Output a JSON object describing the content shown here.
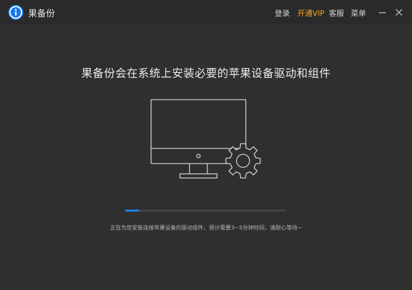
{
  "app": {
    "name": "果备份",
    "logo_icon": "info-circle-icon",
    "brand_color": "#1677e6"
  },
  "header": {
    "menu": [
      {
        "label": "登录"
      },
      {
        "label": "开通VIP",
        "color": "#f5a623"
      },
      {
        "label": "客服"
      },
      {
        "label": "菜单"
      }
    ],
    "window_controls": [
      "minimize-icon",
      "close-icon"
    ]
  },
  "main": {
    "headline": "果备份会在系统上安装必要的苹果设备驱动和组件",
    "illustration": [
      "monitor-icon",
      "gear-icon"
    ],
    "progress": {
      "value": 0.09,
      "color": "#1a7fe8"
    },
    "status_text": "正在为您安装连接苹果设备的驱动组件，预计需要3~5分钟时间，请耐心等待~"
  }
}
